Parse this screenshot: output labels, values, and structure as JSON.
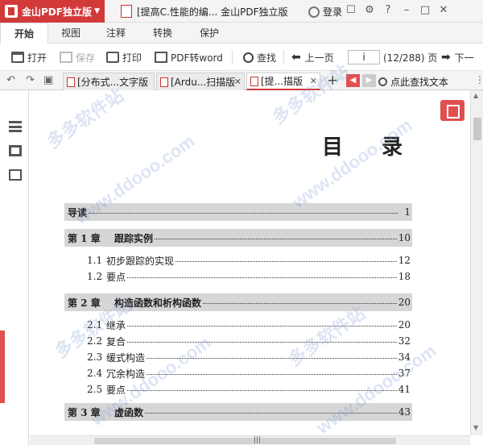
{
  "titlebar": {
    "app_name": "金山PDF独立版",
    "document_title": "[提高C.性能的编... 金山PDF独立版",
    "login_label": "登录",
    "icons": [
      "message-icon",
      "settings-icon",
      "help-icon",
      "minimize-icon",
      "maximize-icon",
      "close-icon"
    ]
  },
  "menu": {
    "tabs": [
      "开始",
      "视图",
      "注释",
      "转换",
      "保护"
    ],
    "active": "开始"
  },
  "toolbar": {
    "open": "打开",
    "save": "保存",
    "print": "打印",
    "pdf_to_word": "PDF转word",
    "find": "查找",
    "prev_page": "上一页",
    "page_input": "i",
    "page_count": "(12/288) 页",
    "next_page": "下一"
  },
  "doc_tabs": [
    {
      "label": "[分布式...文字版"
    },
    {
      "label": "[Ardu...扫描版"
    },
    {
      "label": "[提...描版"
    }
  ],
  "find_text": "点此查找文本",
  "document": {
    "title": "目录",
    "toc": [
      {
        "kind": "chapter",
        "number": "导读",
        "title": "",
        "page": "1"
      },
      {
        "kind": "chapter",
        "number": "第 1 章",
        "title": "跟踪实例",
        "page": "10"
      },
      {
        "kind": "section",
        "number": "1.1",
        "title": "初步跟踪的实现",
        "page": "12"
      },
      {
        "kind": "section",
        "number": "1.2",
        "title": "要点",
        "page": "18"
      },
      {
        "kind": "chapter",
        "number": "第 2 章",
        "title": "构造函数和析构函数",
        "page": "20"
      },
      {
        "kind": "section",
        "number": "2.1",
        "title": "继承",
        "page": "20"
      },
      {
        "kind": "section",
        "number": "2.2",
        "title": "复合",
        "page": "32"
      },
      {
        "kind": "section",
        "number": "2.3",
        "title": "缓式构造",
        "page": "34"
      },
      {
        "kind": "section",
        "number": "2.4",
        "title": "冗余构造",
        "page": "37"
      },
      {
        "kind": "section",
        "number": "2.5",
        "title": "要点",
        "page": "41"
      },
      {
        "kind": "chapter",
        "number": "第 3 章",
        "title": "虚函数",
        "page": "43"
      }
    ]
  },
  "watermarks": [
    "多多软件站",
    "www.ddooo.com"
  ],
  "colors": {
    "brand_red": "#d23a3a",
    "chapter_band": "#d6d6d6",
    "watermark": "#7896d2"
  }
}
